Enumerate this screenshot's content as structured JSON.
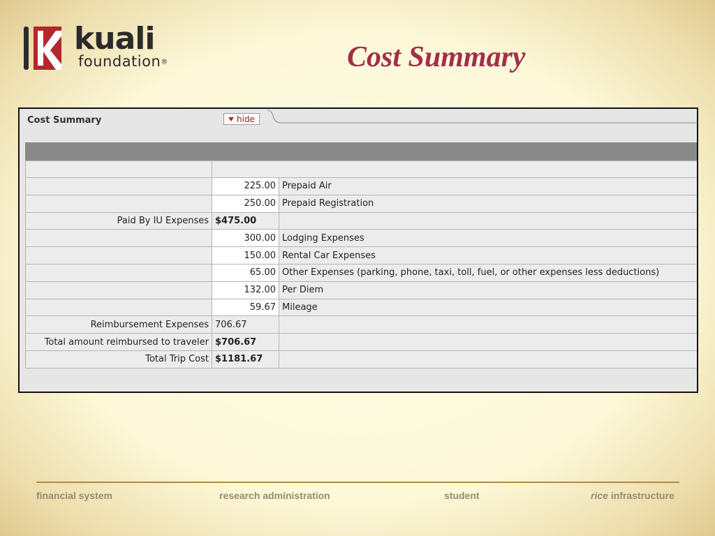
{
  "logo": {
    "word": "kuali",
    "sub": "foundation",
    "reg": "®"
  },
  "slide_title": "Cost Summary",
  "panel": {
    "tab_title": "Cost Summary",
    "hide_label": "hide"
  },
  "rows": [
    {
      "label": "",
      "amount": "225.00",
      "desc": "Prepaid Air"
    },
    {
      "label": "",
      "amount": "250.00",
      "desc": "Prepaid Registration"
    },
    {
      "label": "Paid By IU Expenses",
      "amount": "$475.00",
      "desc": ""
    },
    {
      "label": "",
      "amount": "300.00",
      "desc": "Lodging Expenses"
    },
    {
      "label": "",
      "amount": "150.00",
      "desc": "Rental Car Expenses"
    },
    {
      "label": "",
      "amount": "65.00",
      "desc": "Other Expenses (parking, phone, taxi, toll, fuel, or other expenses less deductions)"
    },
    {
      "label": "",
      "amount": "132.00",
      "desc": "Per Diem"
    },
    {
      "label": "",
      "amount": "59.67",
      "desc": "Mileage"
    },
    {
      "label": "Reimbursement Expenses",
      "amount": "706.67",
      "desc": ""
    },
    {
      "label": "Total amount reimbursed to traveler",
      "amount": "$706.67",
      "desc": ""
    },
    {
      "label": "Total Trip Cost",
      "amount": "$1181.67",
      "desc": ""
    }
  ],
  "footer": {
    "financial": "financial system",
    "research": "research administration",
    "student": "student",
    "rice": "rice",
    "infrastructure": "infrastructure"
  },
  "colors": {
    "title": "#a0304a",
    "logo_red": "#b2282c",
    "footer_line": "#b18a3a"
  }
}
